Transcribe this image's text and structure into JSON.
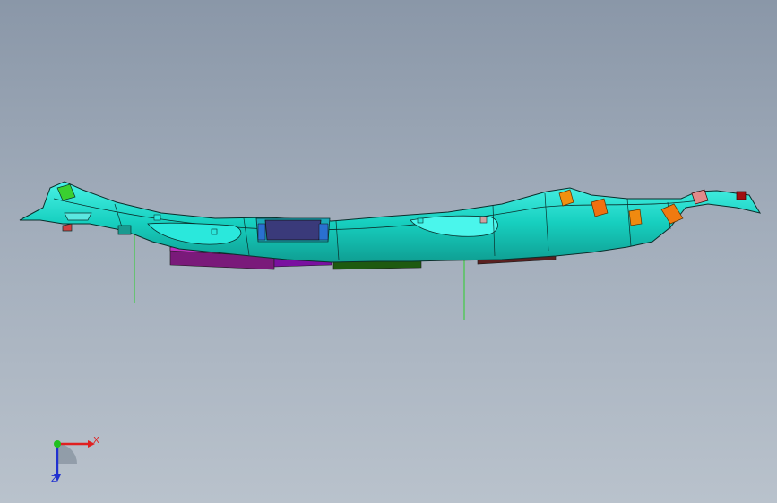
{
  "triad": {
    "x_label": "X",
    "z_label": "Z",
    "x_color": "#e02020",
    "z_color": "#2030d0",
    "y_color": "#20c020"
  },
  "model": {
    "body_color": "#17d0c0",
    "body_highlight": "#3ff0e4",
    "edge_color": "#0a2f2c",
    "pin_color": "#2ad02a"
  }
}
